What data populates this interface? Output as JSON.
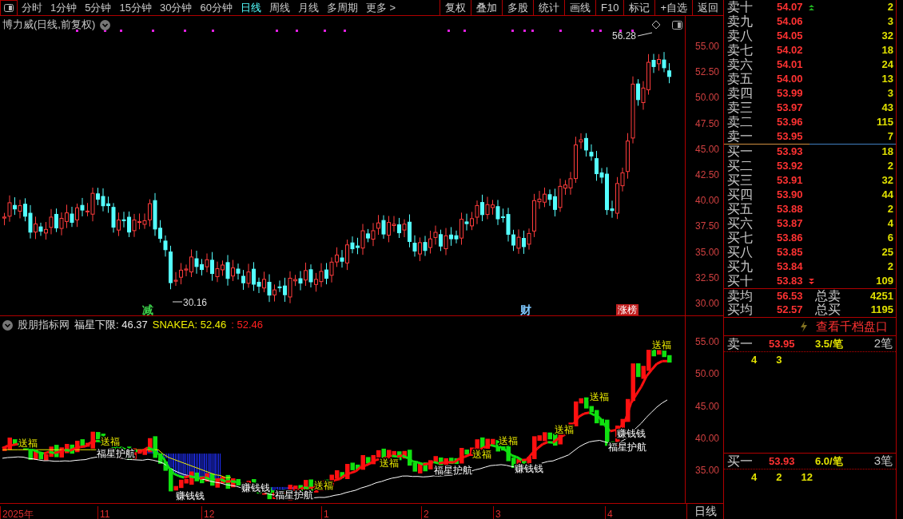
{
  "toolbar": {
    "tabs": [
      {
        "label": "分时",
        "selected": false
      },
      {
        "label": "1分钟",
        "selected": false
      },
      {
        "label": "5分钟",
        "selected": false
      },
      {
        "label": "15分钟",
        "selected": false
      },
      {
        "label": "30分钟",
        "selected": false
      },
      {
        "label": "60分钟",
        "selected": false
      },
      {
        "label": "日线",
        "selected": true
      },
      {
        "label": "周线",
        "selected": false
      },
      {
        "label": "月线",
        "selected": false
      },
      {
        "label": "多周期",
        "selected": false
      },
      {
        "label": "更多 >",
        "selected": false
      }
    ],
    "buttons": [
      "复权",
      "叠加",
      "多股",
      "统计",
      "画线",
      "F10",
      "标记",
      "+自选",
      "返回"
    ]
  },
  "main_chart": {
    "title": "博力威(日线,前复权)",
    "price_axis": [
      "55.00",
      "52.50",
      "50.00",
      "47.50",
      "45.00",
      "42.50",
      "40.00",
      "37.50",
      "35.00",
      "32.50",
      "30.00"
    ],
    "high_label": "56.28",
    "low_label": "30.16",
    "event_tags": [
      {
        "text": "减",
        "kind": "text",
        "color": "#3cd04a"
      },
      {
        "text": "财",
        "kind": "text",
        "color": "#7fc8ff"
      },
      {
        "text": "涨榜",
        "kind": "filled",
        "color": "#c02020"
      }
    ]
  },
  "indicator": {
    "name": "股朋指标网",
    "readouts": [
      {
        "text": "福星下限: 46.37",
        "color": "#e8e8e8"
      },
      {
        "text": "SNAKEA: 52.46",
        "color": "#f0f000"
      },
      {
        "text": ": 52.46",
        "color": "#ff2020"
      }
    ],
    "axis": [
      "55.00",
      "50.00",
      "45.00",
      "40.00",
      "35.00"
    ],
    "signals": [
      {
        "text": "送福",
        "kind": "gift"
      },
      {
        "text": "送福",
        "kind": "gift"
      },
      {
        "text": "福星护航",
        "kind": "guard"
      },
      {
        "text": "赚钱钱",
        "kind": "profit"
      },
      {
        "text": "赚钱钱",
        "kind": "profit"
      },
      {
        "text": "福星护航",
        "kind": "guard"
      },
      {
        "text": "送福",
        "kind": "gift"
      },
      {
        "text": "送福",
        "kind": "gift"
      },
      {
        "text": "福星护航",
        "kind": "guard"
      },
      {
        "text": "送福",
        "kind": "gift"
      },
      {
        "text": "送福",
        "kind": "gift"
      },
      {
        "text": "赚钱钱",
        "kind": "profit"
      },
      {
        "text": "送福",
        "kind": "gift"
      },
      {
        "text": "送福",
        "kind": "gift"
      },
      {
        "text": "赚钱钱",
        "kind": "profit"
      },
      {
        "text": "福星护航",
        "kind": "guard"
      },
      {
        "text": "送福",
        "kind": "gift"
      }
    ]
  },
  "date_axis": {
    "labels": [
      "2025年",
      "11",
      "12",
      "1",
      "2",
      "3",
      "4"
    ],
    "period": "日线"
  },
  "order_book": {
    "asks": [
      {
        "label": "卖十",
        "price": "54.07",
        "volume": "2"
      },
      {
        "label": "卖九",
        "price": "54.06",
        "volume": "3"
      },
      {
        "label": "卖八",
        "price": "54.05",
        "volume": "32"
      },
      {
        "label": "卖七",
        "price": "54.02",
        "volume": "18"
      },
      {
        "label": "卖六",
        "price": "54.01",
        "volume": "24"
      },
      {
        "label": "卖五",
        "price": "54.00",
        "volume": "13"
      },
      {
        "label": "卖四",
        "price": "53.99",
        "volume": "3"
      },
      {
        "label": "卖三",
        "price": "53.97",
        "volume": "43"
      },
      {
        "label": "卖二",
        "price": "53.96",
        "volume": "115"
      },
      {
        "label": "卖一",
        "price": "53.95",
        "volume": "7"
      }
    ],
    "bids": [
      {
        "label": "买一",
        "price": "53.93",
        "volume": "18"
      },
      {
        "label": "买二",
        "price": "53.92",
        "volume": "2"
      },
      {
        "label": "买三",
        "price": "53.91",
        "volume": "32"
      },
      {
        "label": "买四",
        "price": "53.90",
        "volume": "44"
      },
      {
        "label": "买五",
        "price": "53.88",
        "volume": "2"
      },
      {
        "label": "买六",
        "price": "53.87",
        "volume": "4"
      },
      {
        "label": "买七",
        "price": "53.86",
        "volume": "6"
      },
      {
        "label": "买八",
        "price": "53.85",
        "volume": "25"
      },
      {
        "label": "买九",
        "price": "53.84",
        "volume": "2"
      },
      {
        "label": "买十",
        "price": "53.83",
        "volume": "109"
      }
    ],
    "summary": [
      {
        "label": "卖均",
        "price": "56.53",
        "total_label": "总卖",
        "total": "4251"
      },
      {
        "label": "买均",
        "price": "52.57",
        "total_label": "总买",
        "total": "1195"
      }
    ]
  },
  "depth": {
    "link": "查看千档盘口",
    "rows": [
      {
        "label": "卖一",
        "price": "53.95",
        "avg": "3.5/笔",
        "count": "2笔",
        "queue": [
          "4",
          "3"
        ]
      },
      {
        "label": "买一",
        "price": "53.93",
        "avg": "6.0/笔",
        "count": "3笔",
        "queue": [
          "4",
          "2",
          "12"
        ]
      }
    ]
  }
}
